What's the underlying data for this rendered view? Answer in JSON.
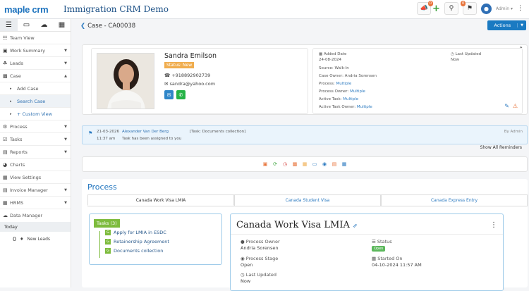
{
  "app": {
    "logo": "maple crm",
    "title": "Immigration CRM Demo",
    "user": "Admin"
  },
  "topbar": {
    "notif_count": "0",
    "bell_count": "0"
  },
  "sidebar": {
    "items": [
      {
        "label": "Team View",
        "icon": "team-icon"
      },
      {
        "label": "Work Summary",
        "icon": "briefcase-icon"
      },
      {
        "label": "Leads",
        "icon": "leads-icon"
      },
      {
        "label": "Case",
        "icon": "folder-icon"
      },
      {
        "label": "Add Case",
        "icon": "chevron-right-icon"
      },
      {
        "label": "Search Case",
        "icon": "chevron-right-icon"
      },
      {
        "label": "+ Custom View",
        "icon": "chevron-right-icon"
      },
      {
        "label": "Process",
        "icon": "gear-icon"
      },
      {
        "label": "Tasks",
        "icon": "tasks-icon"
      },
      {
        "label": "Reports",
        "icon": "reports-icon"
      },
      {
        "label": "Charts",
        "icon": "chart-icon"
      },
      {
        "label": "View Settings",
        "icon": "settings-icon"
      },
      {
        "label": "Invoice Manager",
        "icon": "invoice-icon"
      },
      {
        "label": "HRMS",
        "icon": "hrms-icon"
      },
      {
        "label": "Data Manager",
        "icon": "cloud-icon"
      }
    ],
    "today_label": "Today",
    "new_leads_count": "0",
    "new_leads_label": "New Leads"
  },
  "case": {
    "title": "Case - CA00038",
    "actions_label": "Actions"
  },
  "profile": {
    "name": "Sandra Emilson",
    "status": "Status: New",
    "phone": "+918892902739",
    "email": "sandra@yahoo.com"
  },
  "details": {
    "added_date_label": "Added Date",
    "added_date": "24-08-2024",
    "last_updated_label": "Last Updated",
    "last_updated": "Now",
    "source_label": "Source:",
    "source": "Walk-In",
    "case_owner_label": "Case Owner:",
    "case_owner": "Andria Sorensen",
    "process_label": "Process:",
    "process": "Multiple",
    "process_owner_label": "Process Owner:",
    "process_owner": "Multiple",
    "active_task_label": "Active Task:",
    "active_task": "Multiple",
    "active_task_owner_label": "Active Task Owner:",
    "active_task_owner": "Multiple"
  },
  "reminder": {
    "date": "21-03-2026",
    "time": "11:37 am",
    "author": "Alexander Van Der Berg",
    "context": "[Task: Documents collection]",
    "message": "Task has been assigned to you",
    "by": "By Admin",
    "show_all": "Show All Reminders"
  },
  "process": {
    "title": "Process",
    "tabs": [
      "Canada Work Visa LMIA",
      "Canada Student Visa",
      "Canada Express Entry"
    ],
    "tasks_header": "Tasks (3)",
    "tasks": [
      "Apply for LMIA in ESDC",
      "Retainership Agreement",
      "Documents collection"
    ],
    "card_title": "Canada Work Visa LMIA",
    "process_owner_label": "Process Owner",
    "process_owner": "Andria Sorensen",
    "status_label": "Status",
    "status": "Open",
    "process_stage_label": "Process Stage",
    "process_stage": "Open",
    "started_on_label": "Started On",
    "started_on": "04-10-2024 11:57 AM",
    "last_updated_label": "Last Updated",
    "last_updated": "Now"
  }
}
